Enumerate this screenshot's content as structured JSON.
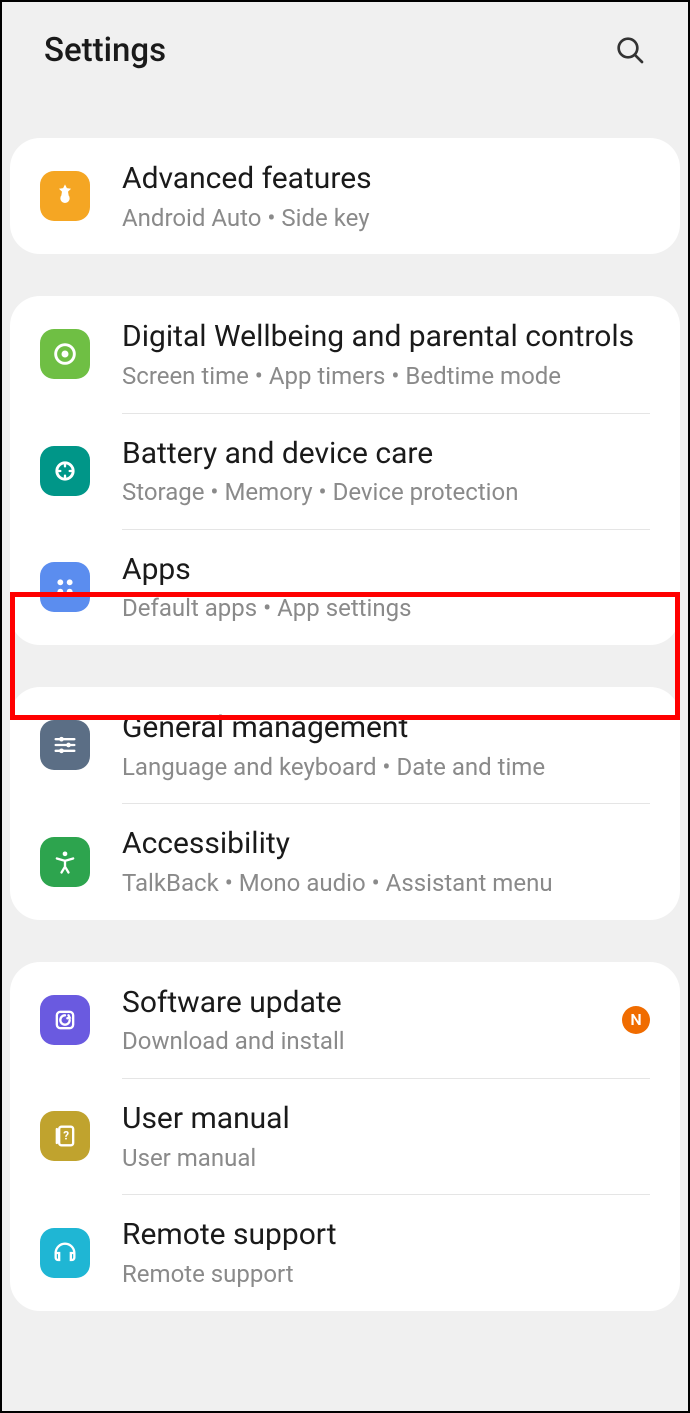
{
  "header": {
    "title": "Settings"
  },
  "groups": [
    {
      "items": [
        {
          "title": "Advanced features",
          "sub": "Android Auto  •  Side key"
        }
      ]
    },
    {
      "items": [
        {
          "title": "Digital Wellbeing and parental controls",
          "sub": "Screen time  •  App timers  •  Bedtime mode"
        },
        {
          "title": "Battery and device care",
          "sub": "Storage  •  Memory  •  Device protection"
        },
        {
          "title": "Apps",
          "sub": "Default apps  •  App settings"
        }
      ]
    },
    {
      "items": [
        {
          "title": "General management",
          "sub": "Language and keyboard  •  Date and time"
        },
        {
          "title": "Accessibility",
          "sub": "TalkBack  •  Mono audio  •  Assistant menu"
        }
      ]
    },
    {
      "items": [
        {
          "title": "Software update",
          "sub": "Download and install",
          "badge": "N"
        },
        {
          "title": "User manual",
          "sub": "User manual"
        },
        {
          "title": "Remote support",
          "sub": "Remote support"
        }
      ]
    }
  ]
}
